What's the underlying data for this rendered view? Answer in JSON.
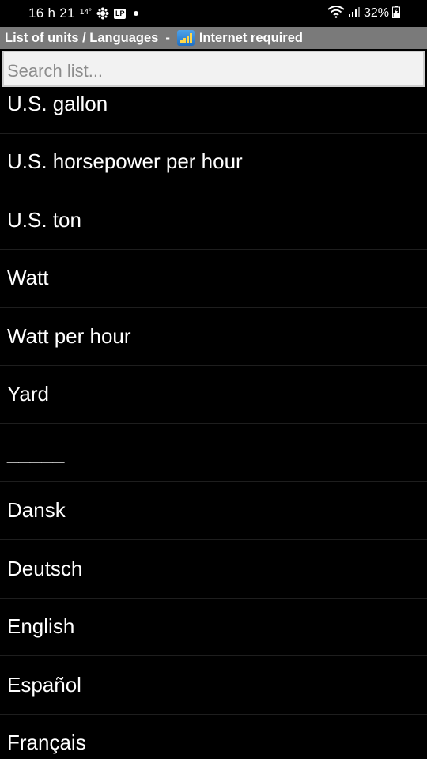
{
  "status_bar": {
    "time": "16 h 21",
    "temperature": "14°",
    "lp_badge": "LP",
    "battery": "32%"
  },
  "title_bar": {
    "title": "List of units / Languages",
    "separator": "-",
    "internet_label": "Internet required"
  },
  "search": {
    "placeholder": "Search list...",
    "value": ""
  },
  "list": {
    "items": [
      "U.S. gallon",
      "U.S. horsepower per hour",
      "U.S. ton",
      "Watt",
      "Watt per hour",
      "Yard",
      "_____",
      "Dansk",
      "Deutsch",
      "English",
      "Español",
      "Français"
    ]
  }
}
